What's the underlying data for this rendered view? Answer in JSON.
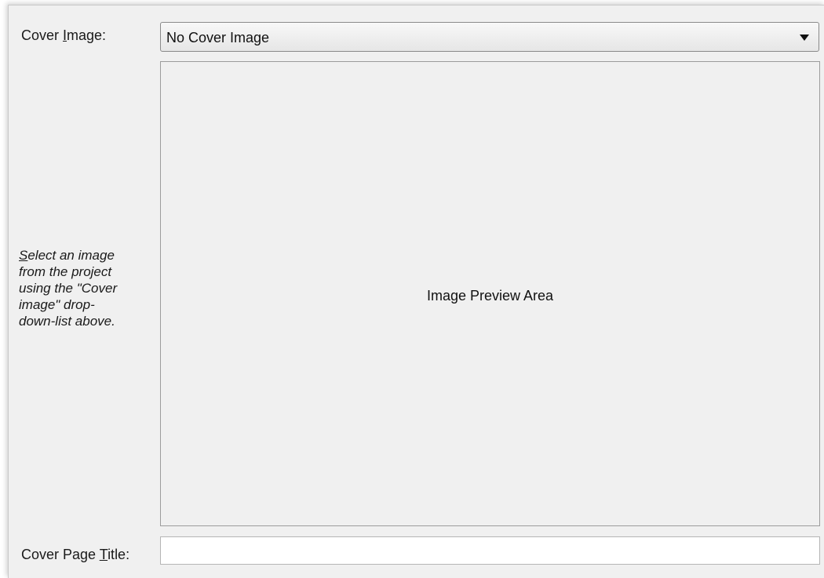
{
  "cover_image": {
    "label_before": "Cover ",
    "label_mnemonic": "I",
    "label_after": "mage:",
    "selected_value": "No Cover Image"
  },
  "hint": {
    "mnemonic": "S",
    "line1_rest": "elect an image",
    "line2": "from the project",
    "line3": "using the \"Cover",
    "line4": "image\" drop-",
    "line5": "down-list above."
  },
  "preview": {
    "text": "Image Preview Area"
  },
  "cover_page_title": {
    "label_before": "Cover Page ",
    "label_mnemonic": "T",
    "label_after": "itle:",
    "value": ""
  }
}
